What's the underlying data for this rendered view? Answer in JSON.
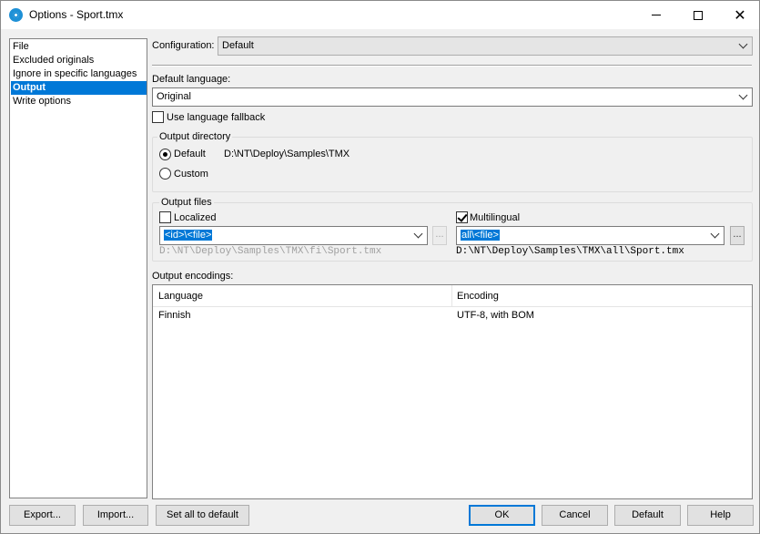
{
  "window": {
    "title": "Options - Sport.tmx"
  },
  "sidebar": {
    "items": [
      {
        "label": "File"
      },
      {
        "label": "Excluded originals"
      },
      {
        "label": "Ignore in specific languages"
      },
      {
        "label": "Output"
      },
      {
        "label": "Write options"
      }
    ],
    "selected": "Output"
  },
  "configuration": {
    "label": "Configuration:",
    "value": "Default"
  },
  "default_language": {
    "label": "Default language:",
    "value": "Original"
  },
  "use_fallback": {
    "label": "Use language fallback",
    "checked": false
  },
  "output_directory": {
    "title": "Output directory",
    "default_label": "Default",
    "default_path": "D:\\NT\\Deploy\\Samples\\TMX",
    "custom_label": "Custom",
    "selected": "Default"
  },
  "output_files": {
    "title": "Output files",
    "localized": {
      "label": "Localized",
      "checked": false,
      "pattern": "<id>\\<file>",
      "dots": "...",
      "path": "D:\\NT\\Deploy\\Samples\\TMX\\fi\\Sport.tmx"
    },
    "multilingual": {
      "label": "Multilingual",
      "checked": true,
      "pattern": "all\\<file>",
      "dots": "...",
      "path": "D:\\NT\\Deploy\\Samples\\TMX\\all\\Sport.tmx"
    }
  },
  "output_encodings": {
    "label": "Output encodings:",
    "columns": [
      "Language",
      "Encoding"
    ],
    "rows": [
      {
        "language": "Finnish",
        "encoding": "UTF-8, with BOM"
      }
    ]
  },
  "buttons": {
    "export": "Export...",
    "import": "Import...",
    "set_all_default": "Set all to default",
    "ok": "OK",
    "cancel": "Cancel",
    "default": "Default",
    "help": "Help"
  },
  "colors": {
    "selection": "#0078d7",
    "window_bg": "#f0f0f0"
  }
}
